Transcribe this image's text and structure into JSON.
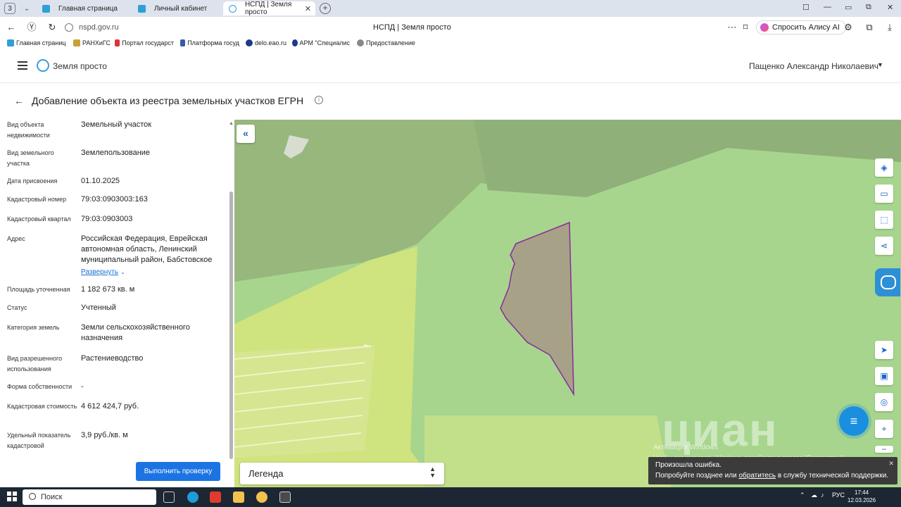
{
  "browser": {
    "tab_count": "3",
    "tabs": [
      {
        "label": "Главная страница"
      },
      {
        "label": "Личный кабинет"
      },
      {
        "label": "НСПД | Земля просто"
      }
    ],
    "url": "nspd.gov.ru",
    "page_title": "НСПД | Земля просто",
    "alice_label": "Спросить Алису AI",
    "bookmarks": [
      {
        "label": "Главная страниц"
      },
      {
        "label": "РАНХиГС"
      },
      {
        "label": "Портал государст"
      },
      {
        "label": "Платформа госуд"
      },
      {
        "label": "delo.eao.ru"
      },
      {
        "label": "АРМ \"Специалис"
      },
      {
        "label": "Предоставление"
      }
    ]
  },
  "app": {
    "brand": "Земля просто",
    "user_name": "Пащенко Александр Николаевич",
    "page_title": "Добавление объекта из реестра земельных участков ЕГРН"
  },
  "details": {
    "rows": [
      {
        "label": "Вид объекта недвижимости",
        "value": "Земельный участок"
      },
      {
        "label": "Вид земельного участка",
        "value": "Землепользование"
      },
      {
        "label": "Дата присвоения",
        "value": "01.10.2025"
      },
      {
        "label": "Кадастровый номер",
        "value": "79:03:0903003:163"
      },
      {
        "label": "Кадастровый квартал",
        "value": "79:03:0903003"
      },
      {
        "label": "Адрес",
        "value": "Российская Федерация, Еврейская автономная область, Ленинский муниципальный район, Бабстовское"
      },
      {
        "label": "Площадь уточненная",
        "value": "1 182 673 кв. м"
      },
      {
        "label": "Статус",
        "value": "Учтенный"
      },
      {
        "label": "Категория земель",
        "value": "Земли сельскохозяйственного назначения"
      },
      {
        "label": "Вид разрешенного использования",
        "value": "Растениеводство"
      },
      {
        "label": "Форма собственности",
        "value": "-"
      },
      {
        "label": "Кадастровая стоимость",
        "value": "4 612 424,7 руб."
      },
      {
        "label": "Удельный показатель кадастровой",
        "value": "3,9 руб./кв. м"
      }
    ],
    "expand_label": "Развернуть",
    "check_button": "Выполнить проверку"
  },
  "map": {
    "legend_label": "Легенда",
    "watermark_line1": "Активация Windows",
    "watermark_line2": "Чтобы активировать Windows, перейдите в раздел \"Параметры\".",
    "cian_text": "циан"
  },
  "toast": {
    "title": "Произошла ошибка.",
    "text_before": "Попробуйте позднее или ",
    "link": "обратитесь",
    "text_after": " в службу технической поддержки."
  },
  "taskbar": {
    "search_label": "Поиск",
    "lang": "РУС",
    "time": "17:44",
    "date": "12.03.2026"
  },
  "colors": {
    "accent": "#1c74e3",
    "map_green": "#a7d58d",
    "parcel_border": "#8b2a9e"
  }
}
